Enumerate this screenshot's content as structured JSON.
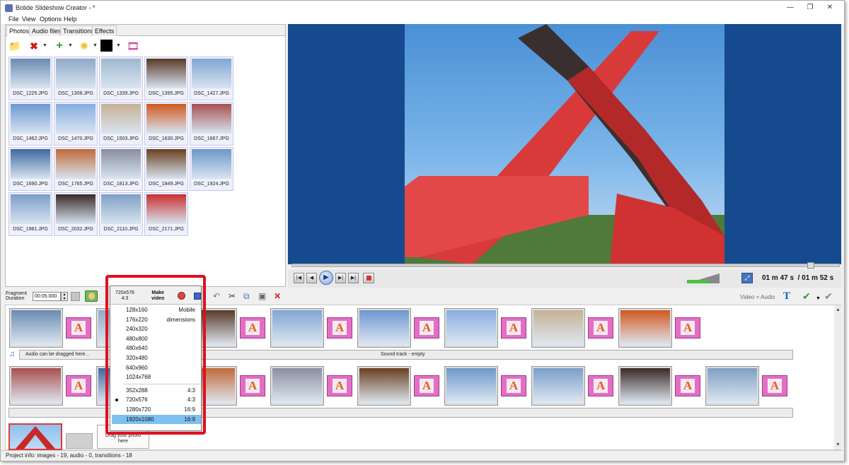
{
  "window": {
    "title": "Bolide Slideshow Creator - *",
    "minimize_glyph": "—",
    "maximize_glyph": "❐",
    "close_glyph": "✕"
  },
  "menu": [
    "File",
    "View",
    "Options",
    "Help"
  ],
  "tabs": [
    {
      "label": "Photos",
      "active": true
    },
    {
      "label": "Audio files",
      "active": false
    },
    {
      "label": "Transitions",
      "active": false
    },
    {
      "label": "Effects",
      "active": false
    }
  ],
  "photos_toolbar": [
    "open-folder-icon",
    "delete-icon",
    "add-icon",
    "brightness-icon",
    "color-swatch",
    "film-strip-icon"
  ],
  "photos": [
    {
      "name": "DSC_1225.JPG",
      "color": "#6b8bb0"
    },
    {
      "name": "DSC_1308.JPG",
      "color": "#8fa9c5"
    },
    {
      "name": "DSC_1339.JPG",
      "color": "#9fb8d0"
    },
    {
      "name": "DSC_1395.JPG",
      "color": "#5a3a28"
    },
    {
      "name": "DSC_1427.JPG",
      "color": "#7fa6d4"
    },
    {
      "name": "DSC_1462.JPG",
      "color": "#6e98d0"
    },
    {
      "name": "DSC_1470.JPG",
      "color": "#87aee0"
    },
    {
      "name": "DSC_1503.JPG",
      "color": "#c7b196"
    },
    {
      "name": "DSC_1630.JPG",
      "color": "#d05a20"
    },
    {
      "name": "DSC_1667.JPG",
      "color": "#a85050"
    },
    {
      "name": "DSC_1690.JPG",
      "color": "#3f6aa0"
    },
    {
      "name": "DSC_1765.JPG",
      "color": "#c06a3a"
    },
    {
      "name": "DSC_1813.JPG",
      "color": "#8a8fa0"
    },
    {
      "name": "DSC_1849.JPG",
      "color": "#6a4020"
    },
    {
      "name": "DSC_1924.JPG",
      "color": "#6c98c8"
    },
    {
      "name": "DSC_1981.JPG",
      "color": "#7b9ec9"
    },
    {
      "name": "DSC_2032.JPG",
      "color": "#3a2a25"
    },
    {
      "name": "DSC_2110.JPG",
      "color": "#7fa0c4"
    },
    {
      "name": "DSC_2171.JPG",
      "color": "#c83030"
    }
  ],
  "player": {
    "buttons": [
      "skip-start",
      "prev",
      "play",
      "next",
      "skip-end"
    ],
    "time_current": "01 m 47 s",
    "time_total": "/ 01 m 52 s",
    "volume": 0.65,
    "seek_progress": 0.95
  },
  "storyboard_toolbar": {
    "fragment_duration_label_1": "Fragment",
    "fragment_duration_label_2": "Duration",
    "fragment_duration_value": "00:05.000",
    "video_audio_label": "Video = Audio",
    "text_icon_glyph": "T"
  },
  "storyboard": {
    "row1": [
      "#6b8bb0",
      "#8fa9c5",
      "#5a3a28",
      "#7fa6d4",
      "#6e98d0",
      "#87aee0",
      "#c7b196",
      "#d05a20"
    ],
    "row2": [
      "#a85050",
      "#3f6aa0",
      "#c06a3a",
      "#8a8fa0",
      "#6a4020",
      "#6c98c8",
      "#7b9ec9",
      "#3a2a25",
      "#7fa0c4"
    ],
    "transition_letter": "A",
    "audio_hint": "Audio can be dragged here...",
    "sound_track": "Sound track - empty",
    "drag_photo_line1": "Drag your photo",
    "drag_photo_line2": "here"
  },
  "status": "Project info: images - 19, audio - 0, transitions - 18",
  "popup": {
    "current_resolution": "720x576",
    "current_aspect": "4:3",
    "make_video_line1": "Make",
    "make_video_line2": "video",
    "mobile_items": [
      {
        "label": "128x160",
        "extra": "Mobile"
      },
      {
        "label": "176x220",
        "extra": "dimensions"
      },
      {
        "label": "240x320",
        "extra": ""
      },
      {
        "label": "480x800",
        "extra": ""
      },
      {
        "label": "480x640",
        "extra": ""
      },
      {
        "label": "320x480",
        "extra": ""
      },
      {
        "label": "640x960",
        "extra": ""
      },
      {
        "label": "1024x768",
        "extra": ""
      }
    ],
    "video_items": [
      {
        "label": "352x288",
        "extra": "4:3",
        "checked": false,
        "selected": false
      },
      {
        "label": "720x576",
        "extra": "4:3",
        "checked": true,
        "selected": false
      },
      {
        "label": "1280x720",
        "extra": "16:9",
        "checked": false,
        "selected": false
      },
      {
        "label": "1920x1080",
        "extra": "16:9",
        "checked": false,
        "selected": true
      }
    ]
  },
  "colors": {
    "preview_bg": "#164a8e",
    "highlight": "#e0101e",
    "selection": "#7ec0f0"
  }
}
